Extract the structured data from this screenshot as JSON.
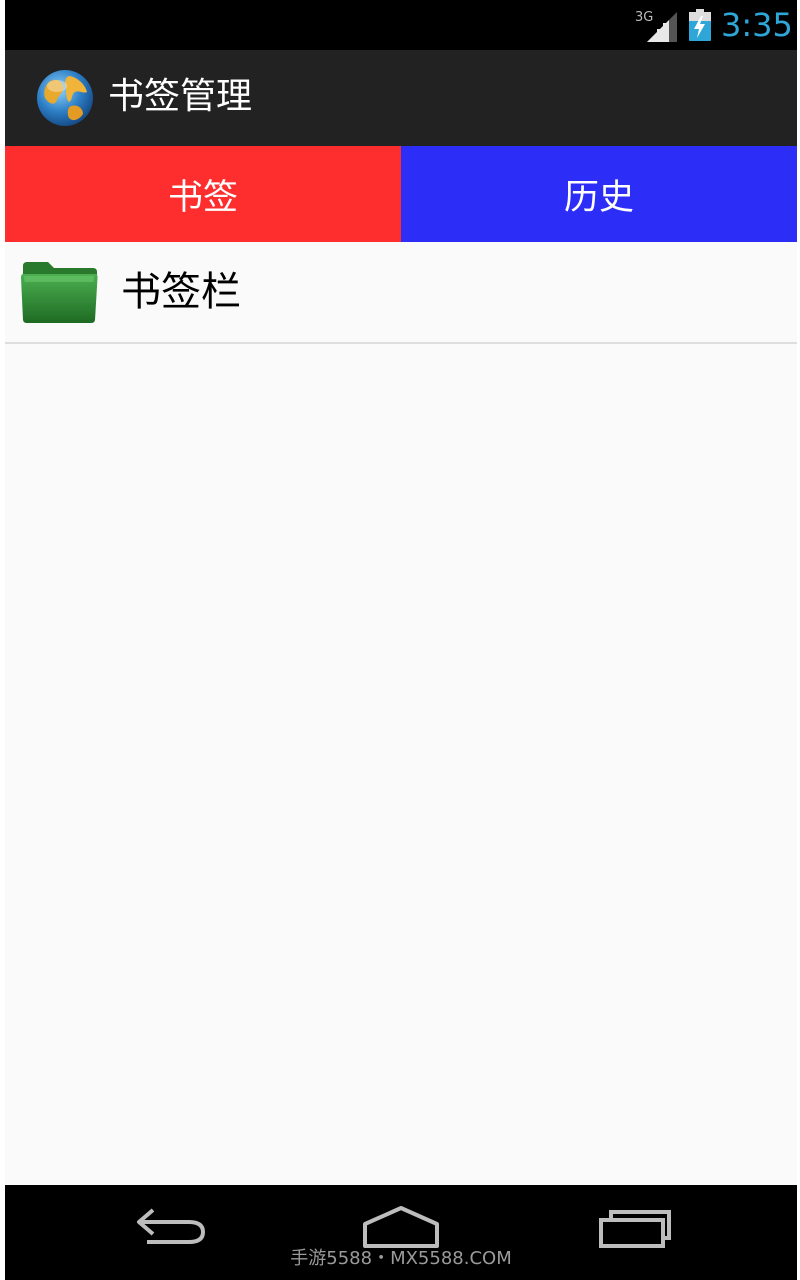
{
  "status_bar": {
    "network": "3G",
    "time": "3:35",
    "icons": [
      "signal-3g-icon",
      "battery-charging-icon"
    ],
    "clock_color": "#2fa6d8"
  },
  "action_bar": {
    "title": "书签管理",
    "icon": "globe-icon"
  },
  "tabs": [
    {
      "label": "书签",
      "color": "#fe2e2f"
    },
    {
      "label": "历史",
      "color": "#2d2df8"
    }
  ],
  "list": {
    "items": [
      {
        "label": "书签栏",
        "icon": "folder-icon",
        "icon_color": "#2a8a2e"
      }
    ]
  },
  "nav_bar": {
    "icons": [
      "back-icon",
      "home-icon",
      "recent-apps-icon"
    ],
    "watermark": "手游5588・MX5588.COM"
  }
}
